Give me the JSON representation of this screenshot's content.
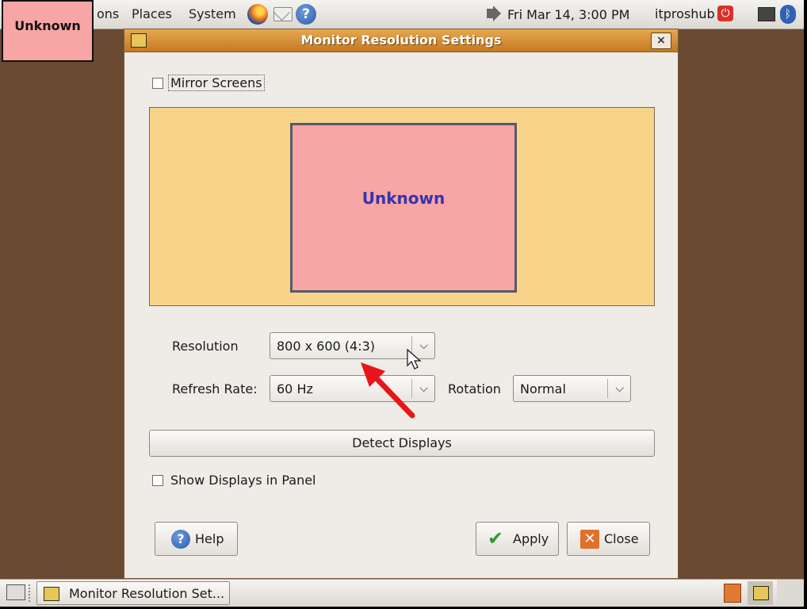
{
  "top_panel": {
    "menus": [
      "ons",
      "Places",
      "System"
    ],
    "clock": "Fri Mar 14,  3:00 PM",
    "user": "itproshub"
  },
  "corner_label": "Unknown",
  "dialog": {
    "title": "Monitor Resolution Settings",
    "close_glyph": "×",
    "mirror_screens": {
      "label": "Mirror Screens",
      "checked": false
    },
    "monitor_name": "Unknown",
    "resolution": {
      "label": "Resolution",
      "value": "800 x 600 (4:3)"
    },
    "refresh_rate": {
      "label": "Refresh Rate:",
      "value": "60 Hz"
    },
    "rotation": {
      "label": "Rotation",
      "value": "Normal"
    },
    "detect_button": "Detect Displays",
    "show_in_panel": {
      "label": "Show Displays in Panel",
      "checked": false
    },
    "help_button": "Help",
    "apply_button": "Apply",
    "close_button": "Close"
  },
  "taskbar": {
    "task_label": "Monitor Resolution Set..."
  },
  "colors": {
    "desktop": "#6b4a32",
    "titlebar": "#d8923a",
    "preview_bg": "#f8d48a",
    "monitor_fill": "#f7a5a5",
    "annotation_arrow": "#e8161a"
  }
}
